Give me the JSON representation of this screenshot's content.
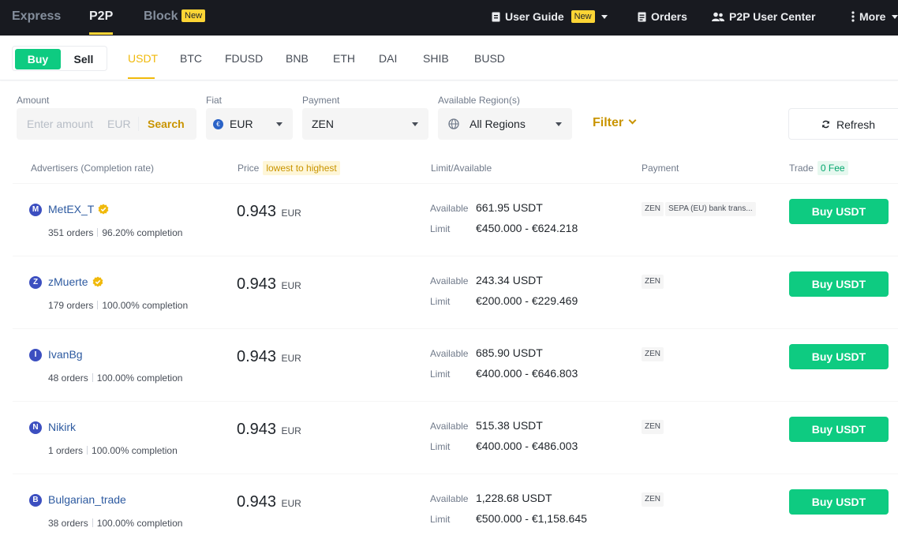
{
  "nav": {
    "express": "Express",
    "p2p": "P2P",
    "block": "Block",
    "block_badge": "New",
    "user_guide": "User Guide",
    "user_guide_badge": "New",
    "orders": "Orders",
    "user_center": "P2P User Center",
    "more": "More"
  },
  "trade_toggle": {
    "buy": "Buy",
    "sell": "Sell"
  },
  "coins": [
    "USDT",
    "BTC",
    "FDUSD",
    "BNB",
    "ETH",
    "DAI",
    "SHIB",
    "BUSD"
  ],
  "filters": {
    "amount_label": "Amount",
    "amount_placeholder": "Enter amount",
    "amount_currency": "EUR",
    "search": "Search",
    "fiat_label": "Fiat",
    "fiat_value": "EUR",
    "payment_label": "Payment",
    "payment_value": "ZEN",
    "region_label": "Available Region(s)",
    "region_value": "All Regions",
    "filter": "Filter",
    "refresh": "Refresh"
  },
  "table_header": {
    "advertisers": "Advertisers (Completion rate)",
    "price": "Price",
    "price_sort": "lowest to highest",
    "limit": "Limit/Available",
    "payment": "Payment",
    "trade": "Trade",
    "fee": "0 Fee"
  },
  "labels": {
    "available": "Available",
    "limit": "Limit"
  },
  "rows": [
    {
      "initial": "M",
      "name": "MetEX_T",
      "verified": true,
      "orders": "351 orders",
      "completion": "96.20% completion",
      "price": "0.943",
      "currency": "EUR",
      "available": "661.95 USDT",
      "limit": "€450.000 - €624.218",
      "payments": [
        "ZEN",
        "SEPA (EU) bank trans..."
      ],
      "button": "Buy USDT"
    },
    {
      "initial": "Z",
      "name": "zMuerte",
      "verified": true,
      "orders": "179 orders",
      "completion": "100.00% completion",
      "price": "0.943",
      "currency": "EUR",
      "available": "243.34 USDT",
      "limit": "€200.000 - €229.469",
      "payments": [
        "ZEN"
      ],
      "button": "Buy USDT"
    },
    {
      "initial": "I",
      "name": "IvanBg",
      "verified": false,
      "orders": "48 orders",
      "completion": "100.00% completion",
      "price": "0.943",
      "currency": "EUR",
      "available": "685.90 USDT",
      "limit": "€400.000 - €646.803",
      "payments": [
        "ZEN"
      ],
      "button": "Buy USDT"
    },
    {
      "initial": "N",
      "name": "Nikirk",
      "verified": false,
      "orders": "1 orders",
      "completion": "100.00% completion",
      "price": "0.943",
      "currency": "EUR",
      "available": "515.38 USDT",
      "limit": "€400.000 - €486.003",
      "payments": [
        "ZEN"
      ],
      "button": "Buy USDT"
    },
    {
      "initial": "B",
      "name": "Bulgarian_trade",
      "verified": false,
      "orders": "38 orders",
      "completion": "100.00% completion",
      "price": "0.943",
      "currency": "EUR",
      "available": "1,228.68 USDT",
      "limit": "€500.000 - €1,158.645",
      "payments": [
        "ZEN"
      ],
      "button": "Buy USDT"
    }
  ],
  "colors": {
    "buy_green": "#0ecb81",
    "brand_yellow": "#fcd535",
    "link_blue": "#2d5aa0",
    "nav_bg": "#181a20"
  }
}
